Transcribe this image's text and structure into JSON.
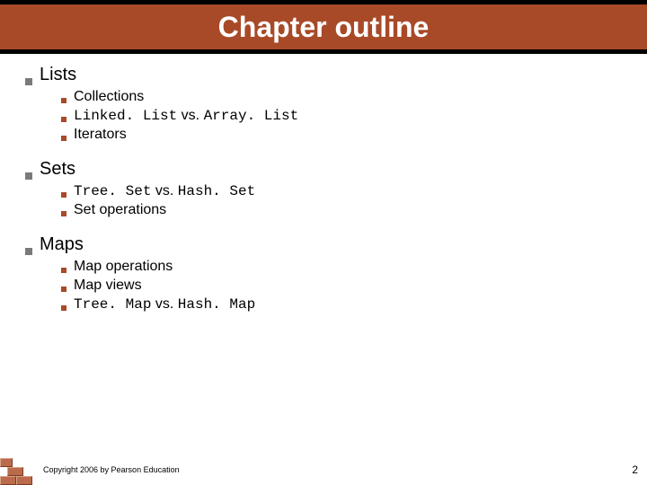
{
  "title": "Chapter outline",
  "sections": [
    {
      "heading": "Lists",
      "items": [
        {
          "parts": [
            {
              "t": "Collections",
              "code": false
            }
          ]
        },
        {
          "parts": [
            {
              "t": "Linked. List",
              "code": true
            },
            {
              "t": " vs. ",
              "code": false
            },
            {
              "t": "Array. List",
              "code": true
            }
          ]
        },
        {
          "parts": [
            {
              "t": "Iterators",
              "code": false
            }
          ]
        }
      ]
    },
    {
      "heading": "Sets",
      "items": [
        {
          "parts": [
            {
              "t": "Tree. Set",
              "code": true
            },
            {
              "t": " vs. ",
              "code": false
            },
            {
              "t": "Hash. Set",
              "code": true
            }
          ]
        },
        {
          "parts": [
            {
              "t": "Set operations",
              "code": false
            }
          ]
        }
      ]
    },
    {
      "heading": "Maps",
      "items": [
        {
          "parts": [
            {
              "t": "Map operations",
              "code": false
            }
          ]
        },
        {
          "parts": [
            {
              "t": "Map views",
              "code": false
            }
          ]
        },
        {
          "parts": [
            {
              "t": "Tree. Map",
              "code": true
            },
            {
              "t": " vs. ",
              "code": false
            },
            {
              "t": "Hash. Map",
              "code": true
            }
          ]
        }
      ]
    }
  ],
  "footer": "Copyright 2006 by Pearson Education",
  "page_number": "2",
  "colors": {
    "accent": "#a84a28",
    "bullet_l1": "#7a7a7a",
    "bullet_l2": "#a84a28"
  }
}
